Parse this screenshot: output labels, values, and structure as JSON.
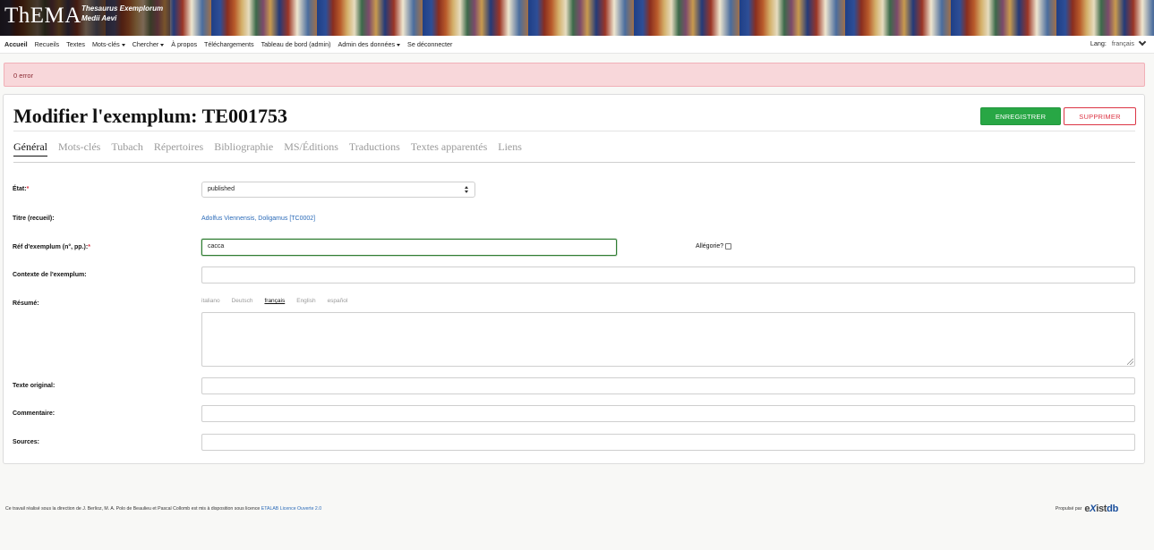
{
  "banner": {
    "logo": "ThEMA",
    "subtitle_line1": "Thesaurus Exemplorum",
    "subtitle_line2": "Medii Aevi"
  },
  "nav": {
    "items": [
      {
        "label": "Accueil",
        "active": true,
        "dropdown": false
      },
      {
        "label": "Recueils",
        "dropdown": false
      },
      {
        "label": "Textes",
        "dropdown": false
      },
      {
        "label": "Mots-clés",
        "dropdown": true
      },
      {
        "label": "Chercher",
        "dropdown": true
      },
      {
        "label": "À propos",
        "dropdown": false
      },
      {
        "label": "Téléchargements",
        "dropdown": false
      },
      {
        "label": "Tableau de bord (admin)",
        "dropdown": false
      },
      {
        "label": "Admin des données",
        "dropdown": true
      },
      {
        "label": "Se déconnecter",
        "dropdown": false
      }
    ],
    "lang_label": "Lang:",
    "lang_value": "français"
  },
  "alert": {
    "text": "0 error"
  },
  "form": {
    "title": "Modifier l'exemplum: TE001753",
    "save_label": "Enregistrer",
    "delete_label": "Supprimer",
    "tabs": [
      {
        "label": "Général",
        "active": true
      },
      {
        "label": "Mots-clés"
      },
      {
        "label": "Tubach"
      },
      {
        "label": "Répertoires"
      },
      {
        "label": "Bibliographie"
      },
      {
        "label": "MS/Éditions"
      },
      {
        "label": "Traductions"
      },
      {
        "label": "Textes apparentés"
      },
      {
        "label": "Liens"
      }
    ],
    "etat_label": "État:",
    "etat_value": "published",
    "titre_label": "Titre (recueil):",
    "titre_value": "Adolfus Viennensis, Doligamus [TC0002]",
    "ref_label": "Réf d'exemplum (n°, pp.):",
    "ref_value": "cacca",
    "allegorie_label": "Allégorie?",
    "contexte_label": "Contexte de l'exemplum",
    "resume_label": "Résumé",
    "resume_langs": [
      {
        "label": "italiano"
      },
      {
        "label": "Deutsch"
      },
      {
        "label": "français",
        "active": true
      },
      {
        "label": "English"
      },
      {
        "label": "español"
      }
    ],
    "texte_label": "Texte original",
    "commentaire_label": "Commentaire",
    "sources_label": "Sources"
  },
  "footer": {
    "credit_text": "Ce travail réalisé sous la direction de J. Berlioz, M. A. Polo de Beaulieu et Pascal Collomb est mis à disposition sous licence",
    "license_link": "ETALAB Licence Ouverte 2.0",
    "powered_by": "Propulsé par",
    "exist_e": "e",
    "exist_x": "X",
    "exist_ist": "ist",
    "exist_db": "db"
  },
  "colors": {
    "save_green": "#28a745",
    "delete_red": "#dc3545",
    "alert_bg": "#f8d7da",
    "link_blue": "#2a6ab8"
  }
}
